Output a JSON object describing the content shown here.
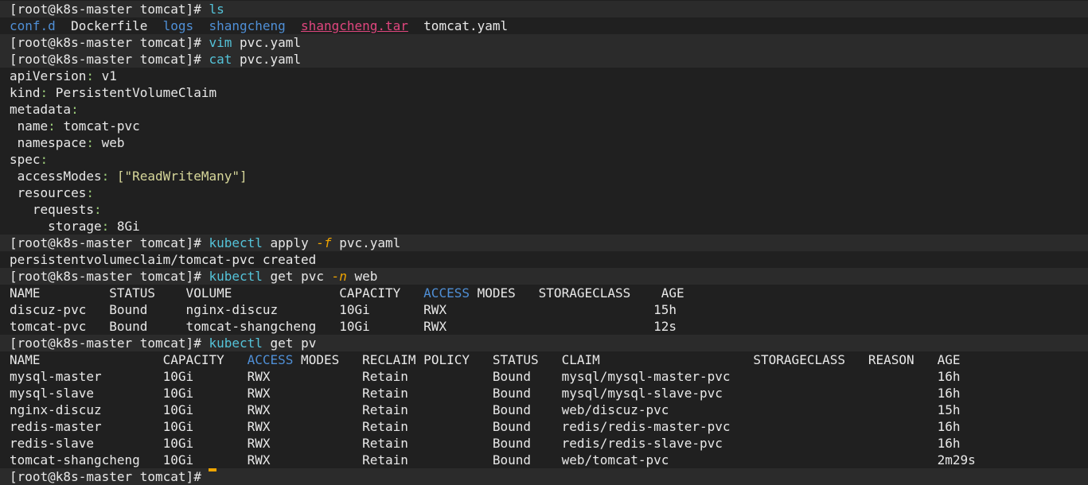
{
  "window": {
    "title": "",
    "prompt": "[root@k8s-master tomcat]#"
  },
  "lines": [
    {
      "type": "prompt",
      "cmd": "ls",
      "args": ""
    },
    {
      "type": "ls",
      "items": [
        "conf.d",
        "Dockerfile",
        "logs",
        "shangcheng",
        "shangcheng.tar",
        "tomcat.yaml"
      ]
    },
    {
      "type": "prompt",
      "cmd": "vim",
      "args": " pvc.yaml"
    },
    {
      "type": "prompt",
      "cmd": "cat",
      "args": " pvc.yaml"
    },
    {
      "type": "yaml",
      "key": "apiVersion",
      "value": " v1",
      "indent": ""
    },
    {
      "type": "yaml",
      "key": "kind",
      "value": " PersistentVolumeClaim",
      "indent": ""
    },
    {
      "type": "yaml",
      "key": "metadata",
      "value": "",
      "indent": ""
    },
    {
      "type": "yaml",
      "key": "name",
      "value": " tomcat-pvc",
      "indent": " "
    },
    {
      "type": "yaml",
      "key": "namespace",
      "value": " web",
      "indent": " "
    },
    {
      "type": "yaml",
      "key": "spec",
      "value": "",
      "indent": ""
    },
    {
      "type": "yaml-str",
      "key": "accessModes",
      "value": " [\"ReadWriteMany\"]",
      "indent": " "
    },
    {
      "type": "yaml",
      "key": "resources",
      "value": "",
      "indent": " "
    },
    {
      "type": "yaml",
      "key": "requests",
      "value": "",
      "indent": "   "
    },
    {
      "type": "yaml",
      "key": "storage",
      "value": " 8Gi",
      "indent": "     "
    },
    {
      "type": "prompt",
      "cmd": "kubectl",
      "args": " apply ",
      "flag": "-f",
      "rest": " pvc.yaml"
    },
    {
      "type": "text",
      "text": "persistentvolumeclaim/tomcat-pvc created"
    },
    {
      "type": "prompt",
      "cmd": "kubectl",
      "args": " get pvc ",
      "flag": "-n",
      "rest": " web"
    },
    {
      "type": "pvc-header",
      "a": "NAME         STATUS    VOLUME              CAPACITY   ",
      "b": "ACCESS",
      "c": " MODES   STORAGECLASS    AGE"
    },
    {
      "type": "text",
      "text": "discuz-pvc   Bound     nginx-discuz        10Gi       RWX                           15h"
    },
    {
      "type": "text",
      "text": "tomcat-pvc   Bound     tomcat-shangcheng   10Gi       RWX                           12s"
    },
    {
      "type": "prompt",
      "cmd": "kubectl",
      "args": " get pv",
      "flag": "",
      "rest": ""
    },
    {
      "type": "pv-header",
      "a": "NAME                CAPACITY   ",
      "b": "ACCESS",
      "c": " MODES   RECLAIM POLICY   STATUS   CLAIM                    STORAGECLASS   REASON   AGE"
    },
    {
      "type": "text",
      "text": "mysql-master        10Gi       RWX            Retain           Bound    mysql/mysql-master-pvc                           16h"
    },
    {
      "type": "text",
      "text": "mysql-slave         10Gi       RWX            Retain           Bound    mysql/mysql-slave-pvc                            16h"
    },
    {
      "type": "text",
      "text": "nginx-discuz        10Gi       RWX            Retain           Bound    web/discuz-pvc                                   15h"
    },
    {
      "type": "text",
      "text": "redis-master        10Gi       RWX            Retain           Bound    redis/redis-master-pvc                           16h"
    },
    {
      "type": "text",
      "text": "redis-slave         10Gi       RWX            Retain           Bound    redis/redis-slave-pvc                            16h"
    },
    {
      "type": "text",
      "text": "tomcat-shangcheng   10Gi       RWX            Retain           Bound    web/tomcat-pvc                                   2m29s"
    },
    {
      "type": "prompt-cursor",
      "cmd": "",
      "args": ""
    }
  ],
  "colors": {
    "background": "#202020",
    "prompt_bg": "#2b2b2b",
    "directory": "#4f8fd6",
    "archive": "#e0467e",
    "command": "#54c3d9",
    "flag": "#f0a500",
    "yaml_colon": "#9ccc7a",
    "yaml_string": "#d7d79a",
    "cursor": "#f0a500"
  }
}
